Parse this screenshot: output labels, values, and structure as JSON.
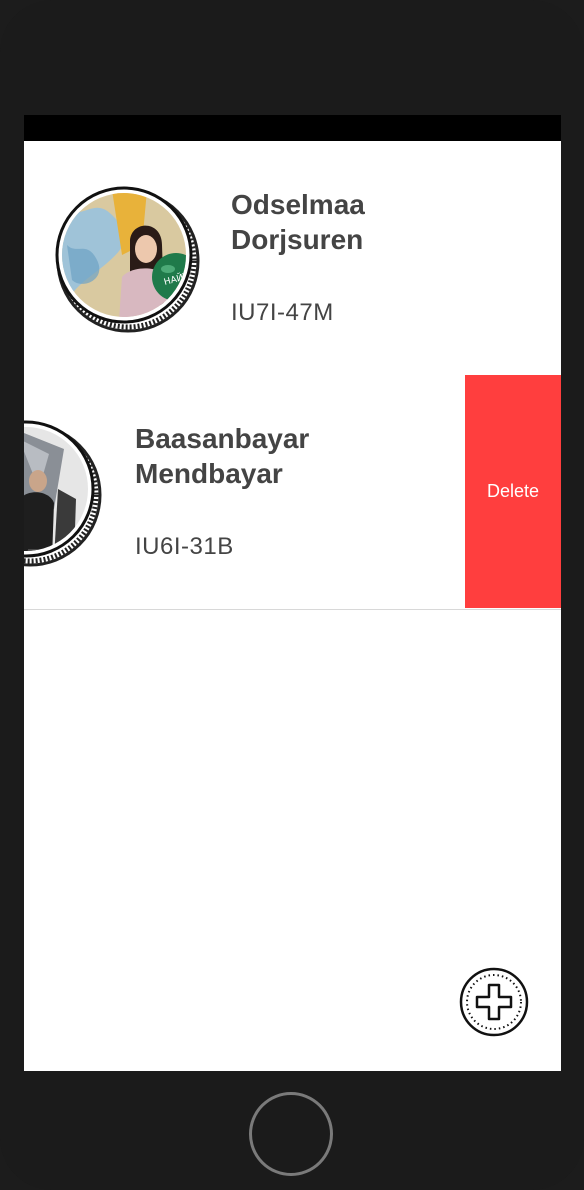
{
  "contacts": [
    {
      "first_name": "Odselmaa",
      "last_name": "Dorjsuren",
      "code": "IU7I-47M",
      "avatar_icon": "photo-avatar"
    },
    {
      "first_name": "Baasanbayar",
      "last_name": "Mendbayar",
      "code": "IU6I-31B",
      "avatar_icon": "photo-avatar"
    }
  ],
  "swipe_action": {
    "delete_label": "Delete"
  },
  "fab": {
    "icon": "plus-icon"
  },
  "colors": {
    "delete": "#ff3e3e",
    "text": "#444444",
    "frame": "#1b1b1b"
  }
}
